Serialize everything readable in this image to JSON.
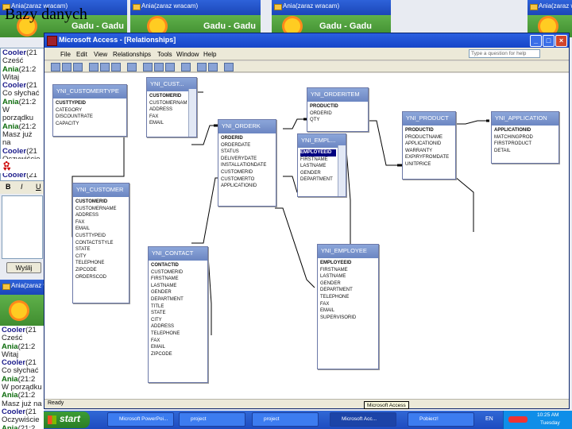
{
  "slide_title": "Bazy danych",
  "chat_windows": [
    {
      "title": "Ania(zaraz wracam)",
      "banner": "Gadu - Gadu"
    },
    {
      "title": "Ania(zaraz wracam)",
      "banner": "Gadu - Gadu"
    },
    {
      "title": "Ania(zaraz wracam)",
      "banner": "Gadu - Gadu"
    },
    {
      "title": "Ania(zaraz wracam)",
      "banner": ""
    }
  ],
  "chat_lines": [
    {
      "who": "Cooler",
      "t": "(21",
      "msg": ""
    },
    {
      "who": "",
      "t": "",
      "msg": "Cześć"
    },
    {
      "who": "Ania",
      "t": "(21:2",
      "msg": ""
    },
    {
      "who": "",
      "t": "",
      "msg": "Witaj"
    },
    {
      "who": "Cooler",
      "t": "(21",
      "msg": ""
    },
    {
      "who": "",
      "t": "",
      "msg": "Co słychać"
    },
    {
      "who": "Ania",
      "t": "(21:2",
      "msg": ""
    },
    {
      "who": "",
      "t": "",
      "msg": "W porządku"
    },
    {
      "who": "Ania",
      "t": "(21:2",
      "msg": ""
    },
    {
      "who": "",
      "t": "",
      "msg": "Masz już na"
    },
    {
      "who": "Cooler",
      "t": "(21",
      "msg": ""
    },
    {
      "who": "",
      "t": "",
      "msg": "Oczywiście"
    },
    {
      "who": "Ania",
      "t": "(21:2",
      "msg": ""
    },
    {
      "who": "Cooler",
      "t": "(21",
      "msg": ""
    }
  ],
  "chat_lines2": [
    {
      "who": "Cooler",
      "t": "(21",
      "msg": ""
    },
    {
      "who": "",
      "t": "",
      "msg": "Cześć"
    },
    {
      "who": "Ania",
      "t": "(21:2",
      "msg": ""
    },
    {
      "who": "",
      "t": "",
      "msg": "Witaj"
    },
    {
      "who": "Cooler",
      "t": "(21",
      "msg": ""
    },
    {
      "who": "",
      "t": "",
      "msg": "Co słychać"
    },
    {
      "who": "Ania",
      "t": "(21:2",
      "msg": ""
    },
    {
      "who": "",
      "t": "",
      "msg": "W porządku"
    },
    {
      "who": "Ania",
      "t": "(21:2",
      "msg": ""
    },
    {
      "who": "",
      "t": "",
      "msg": "Masz już na"
    },
    {
      "who": "Cooler",
      "t": "(21",
      "msg": ""
    },
    {
      "who": "",
      "t": "",
      "msg": "Oczywiście"
    },
    {
      "who": "Ania",
      "t": "(21:2",
      "msg": ""
    }
  ],
  "format_buttons": {
    "bold": "B",
    "italic": "I",
    "underline": "U"
  },
  "send_button": "Wyślij",
  "access": {
    "title": "Microsoft Access - [Relationships]",
    "menu": [
      "File",
      "Edit",
      "View",
      "Relationships",
      "Tools",
      "Window",
      "Help"
    ],
    "help_box": "Type a question for help",
    "status": "Ready",
    "tooltip": "Microsoft Access"
  },
  "tables": [
    {
      "name": "YNI_CUSTOMERTYPE",
      "fields": [
        "CUSTTYPEID",
        "CATEGORY",
        "DISCOUNTRATE",
        "CAPACITY"
      ]
    },
    {
      "name": "YNI_CUST...",
      "fields": [
        "CUSTOMERID",
        "CUSTOMERNAM",
        "ADDRESS",
        "FAX",
        "EMAIL"
      ]
    },
    {
      "name": "YNI_ORDERITEM",
      "fields": [
        "PRODUCTID",
        "ORDERID",
        "QTY"
      ]
    },
    {
      "name": "YNI_PRODUCT",
      "fields": [
        "PRODUCTID",
        "PRODUCTNAME",
        "APPLICATIONID",
        "WARRANTY",
        "EXPIRYFROMDATE",
        "UNITPRICE"
      ]
    },
    {
      "name": "YNI_APPLICATION",
      "fields": [
        "APPLICATIONID",
        "MATCHINGPROD",
        "FIRSTPRODUCT",
        "DETAIL"
      ]
    },
    {
      "name": "YNI_ORDERK",
      "fields": [
        "ORDERID",
        "ORDERDATE",
        "STATUS",
        "DELIVERYDATE",
        "INSTALLATIONDATE",
        "CUSTOMERID",
        "CUSTOMERTO",
        "APPLICATIONID"
      ]
    },
    {
      "name": "YNI_EMPL...",
      "fields": [
        "EMPLOYEEID",
        "FIRSTNAME",
        "LASTNAME",
        "GENDER",
        "DEPARTMENT"
      ]
    },
    {
      "name": "YNI_CUSTOMER",
      "fields": [
        "CUSTOMERID",
        "CUSTOMERNAME",
        "ADDRESS",
        "FAX",
        "EMAIL",
        "CUSTTYPEID",
        "CONTACTSTYLE",
        "STATE",
        "CITY",
        "TELEPHONE",
        "ZIPCODE",
        "ORDERSCOD"
      ]
    },
    {
      "name": "YNI_CONTACT",
      "fields": [
        "CONTACTID",
        "CUSTOMERID",
        "FIRSTNAME",
        "LASTNAME",
        "GENDER",
        "DEPARTMENT",
        "TITLE",
        "STATE",
        "CITY",
        "ADDRESS",
        "TELEPHONE",
        "FAX",
        "EMAIL",
        "ZIPCODE"
      ]
    },
    {
      "name": "YNI_EMPLOYEE",
      "fields": [
        "EMPLOYEEID",
        "FIRSTNAME",
        "LASTNAME",
        "GENDER",
        "DEPARTMENT",
        "TELEPHONE",
        "FAX",
        "EMAIL",
        "SUPERVISORID"
      ]
    }
  ],
  "taskbar": {
    "start": "start",
    "buttons": [
      "Microsoft PowerPoi...",
      "project",
      "project",
      "Microsoft Acc...",
      "Pobierz!"
    ],
    "lang": "EN",
    "clock_time": "10:25 AM",
    "clock_day": "Tuesday"
  }
}
